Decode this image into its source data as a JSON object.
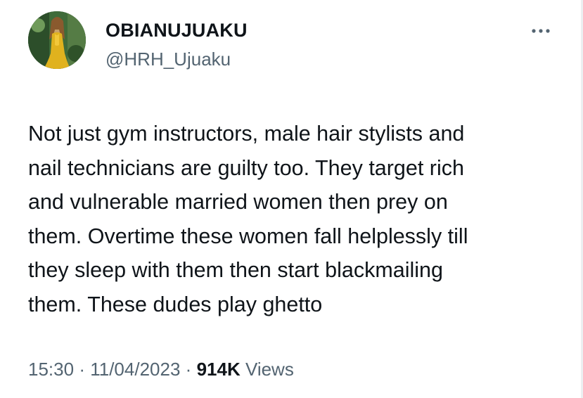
{
  "user": {
    "display_name": "OBIANUJUAKU",
    "handle": "@HRH_Ujuaku"
  },
  "icons": {
    "avatar": "profile-photo-woman-yellow-dress",
    "more": "more-horizontal-icon"
  },
  "tweet": {
    "lines": [
      "Not just gym instructors, male hair stylists and",
      "nail technicians are guilty too. They target rich",
      "and vulnerable married women then prey on",
      "them. Overtime these women fall helplessly till",
      "they sleep with them then start blackmailing",
      "them. These dudes play ghetto"
    ]
  },
  "meta": {
    "time": "15:30",
    "separator": "·",
    "date": "11/04/2023",
    "views_count": "914K",
    "views_label": "Views"
  },
  "colors": {
    "text_primary": "#0f1419",
    "text_secondary": "#536471",
    "background": "#ffffff"
  }
}
